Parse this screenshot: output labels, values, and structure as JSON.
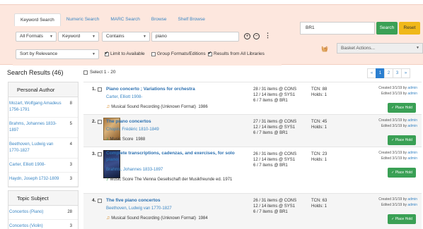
{
  "tabs": [
    "Keyword Search",
    "Numeric Search",
    "MARC Search",
    "Browse",
    "Shelf Browse"
  ],
  "search_form": {
    "format": "All Formats",
    "field": "Keyword",
    "operator": "Contains",
    "query": "piano",
    "add_icon": "plus-circle-icon",
    "remove_icon": "minus-circle-icon",
    "sort": "Sort by Relevance",
    "limit_available": "Limit to Available",
    "group_formats": "Group Formats/Editions",
    "all_libraries": "Results from All Libraries"
  },
  "location_search": {
    "value": "BR1",
    "search_label": "Search",
    "reset_label": "Reset"
  },
  "basket": {
    "icon": "basket-icon",
    "actions_label": "Basket Actions..."
  },
  "results_header": {
    "title": "Search Results (46)",
    "select_label": "Select 1 - 20"
  },
  "pager": [
    "«",
    "1",
    "2",
    "3",
    "»"
  ],
  "facets": [
    {
      "title": "Personal Author",
      "rows": [
        {
          "label": "Mozart, Wolfgang Amadeus 1756-1791",
          "count": "8"
        },
        {
          "label": "Brahms, Johannes 1833-1897",
          "count": "5"
        },
        {
          "label": "Beethoven, Ludwig van 1770-1827",
          "count": "4"
        },
        {
          "label": "Carter, Elliott 1908-",
          "count": "3"
        },
        {
          "label": "Haydn, Joseph 1732-1809",
          "count": "3"
        }
      ]
    },
    {
      "title": "Topic Subject",
      "rows": [
        {
          "label": "Concertos (Piano)",
          "count": "28"
        },
        {
          "label": "Concertos (Violin)",
          "count": "3"
        }
      ]
    }
  ],
  "results": [
    {
      "num": "1.",
      "title": "Piano concerto ; Variations for orchestra",
      "author": "Carter, Elliott 1908-",
      "format": "Musical Sound Recording (Unknown Format)",
      "year": "1986",
      "holdings": [
        "28 / 31 items @ CONS",
        "12 / 14 items @ SYS1",
        "6 / 7 items   @ BR1"
      ],
      "tcn": "TCN: 88",
      "holds": "Holds: 1",
      "created": "Created 3/1/19 by",
      "edited": "Edited 3/1/19 by",
      "by": "admin",
      "place_hold": "Place Hold"
    },
    {
      "num": "2.",
      "title": "The piano concertos",
      "author": "Chopin, Frédéric 1810-1849",
      "format": "Music Score",
      "year": "1988",
      "holdings": [
        "27 / 31 items @ CONS",
        "12 / 14 items @ SYS1",
        "6 / 7 items   @ BR1"
      ],
      "tcn": "TCN: 45",
      "holds": "Holds: 1",
      "created": "Created 3/1/19 by",
      "edited": "Edited 3/1/19 by",
      "by": "admin",
      "place_hold": "Place Hold"
    },
    {
      "num": "3.",
      "title": "Complete transcriptions, cadenzas, and exercises, for solo piano",
      "author": "Brahms, Johannes 1833-1897",
      "format": "Music Score  The Vienna Gesellschaft der Musikfreunde ed.",
      "year": "1971",
      "holdings": [
        "26 / 31 items @ CONS",
        "12 / 14 items @ SYS1",
        "6 / 7 items   @ BR1"
      ],
      "tcn": "TCN: 23",
      "holds": "Holds: 1",
      "created": "Created 3/1/19 by",
      "edited": "Edited 3/1/19 by",
      "by": "admin",
      "place_hold": "Place Hold"
    },
    {
      "num": "4.",
      "title": "The five piano concertos",
      "author": "Beethoven, Ludwig van 1770-1827",
      "format": "Musical Sound Recording (Unknown Format)",
      "year": "1984",
      "holdings": [
        "26 / 31 items @ CONS",
        "12 / 14 items @ SYS1",
        "6 / 7 items   @ BR1"
      ],
      "tcn": "TCN: 63",
      "holds": "Holds: 1",
      "created": "Created 3/1/19 by",
      "edited": "Edited 3/1/19 by",
      "by": "admin",
      "place_hold": "Place Hold"
    }
  ],
  "colors": {
    "header_bg": "#fde7de",
    "link": "#3a86c4",
    "success": "#3aa055",
    "warning": "#f0b81a",
    "active_page": "#2b7fd0"
  }
}
